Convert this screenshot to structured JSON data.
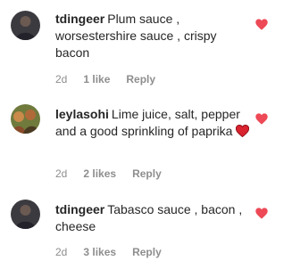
{
  "comments": [
    {
      "username": "tdingeer",
      "text": "Plum sauce , worsestershire sauce , crispy bacon",
      "time": "2d",
      "likes": "1 like",
      "reply": "Reply",
      "heart_icon": "heart-filled-icon",
      "heart_color": "#ed4956"
    },
    {
      "username": "leylasohi",
      "text": "Lime juice, salt, pepper and a good sprinkling of paprika",
      "inline_emoji": "red-heart-emoji",
      "time": "2d",
      "likes": "2 likes",
      "reply": "Reply",
      "heart_icon": "heart-filled-icon",
      "heart_color": "#ed4956"
    },
    {
      "username": "tdingeer",
      "text": "Tabasco sauce , bacon , cheese",
      "time": "2d",
      "likes": "3 likes",
      "reply": "Reply",
      "heart_icon": "heart-filled-icon",
      "heart_color": "#ed4956"
    }
  ]
}
